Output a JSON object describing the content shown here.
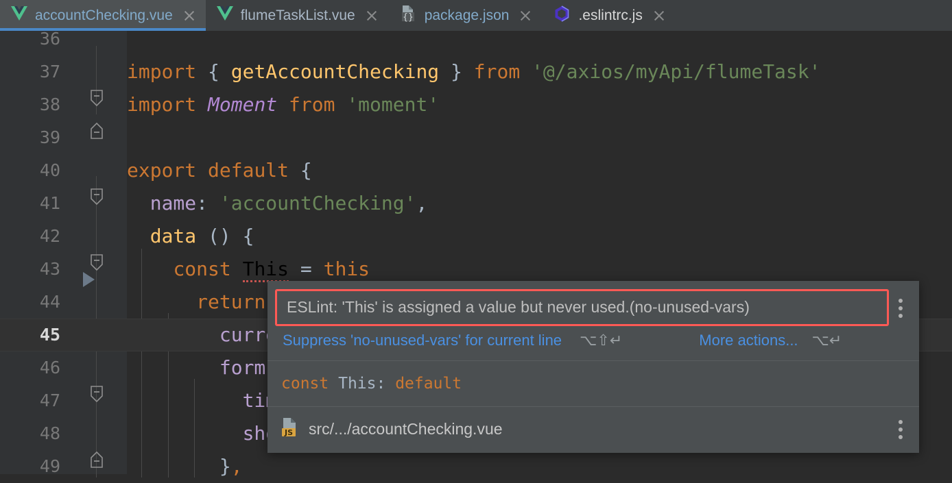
{
  "tabs": [
    {
      "label": "accountChecking.vue",
      "icon": "vue-icon",
      "active": true,
      "close": "close-icon"
    },
    {
      "label": "flumeTaskList.vue",
      "icon": "vue-icon",
      "active": false,
      "close": "close-icon"
    },
    {
      "label": "package.json",
      "icon": "json-file-icon",
      "active": false,
      "close": "close-icon"
    },
    {
      "label": ".eslintrc.js",
      "icon": "eslint-icon",
      "active": false,
      "close": "close-icon"
    }
  ],
  "editor": {
    "lines": [
      {
        "num": "36",
        "current": false,
        "segments": []
      },
      {
        "num": "37",
        "current": false,
        "segments": [
          {
            "t": "import",
            "c": "kw"
          },
          {
            "t": " ",
            "c": "pun"
          },
          {
            "t": "{",
            "c": "pun"
          },
          {
            "t": " ",
            "c": "pun"
          },
          {
            "t": "getAccountChecking",
            "c": "fn"
          },
          {
            "t": " ",
            "c": "pun"
          },
          {
            "t": "}",
            "c": "pun"
          },
          {
            "t": " ",
            "c": "pun"
          },
          {
            "t": "from",
            "c": "kw"
          },
          {
            "t": " ",
            "c": "pun"
          },
          {
            "t": "'@/axios/myApi/flumeTask'",
            "c": "str"
          }
        ]
      },
      {
        "num": "38",
        "current": false,
        "segments": [
          {
            "t": "import",
            "c": "kw"
          },
          {
            "t": " ",
            "c": "pun"
          },
          {
            "t": "Moment",
            "c": "ital"
          },
          {
            "t": " ",
            "c": "pun"
          },
          {
            "t": "from",
            "c": "kw"
          },
          {
            "t": " ",
            "c": "pun"
          },
          {
            "t": "'moment'",
            "c": "str"
          }
        ]
      },
      {
        "num": "39",
        "current": false,
        "segments": []
      },
      {
        "num": "40",
        "current": false,
        "segments": [
          {
            "t": "export",
            "c": "kw"
          },
          {
            "t": " ",
            "c": "pun"
          },
          {
            "t": "default",
            "c": "kw"
          },
          {
            "t": " ",
            "c": "pun"
          },
          {
            "t": "{",
            "c": "pun"
          }
        ]
      },
      {
        "num": "41",
        "current": false,
        "segments": [
          {
            "t": "  ",
            "c": "pun"
          },
          {
            "t": "name",
            "c": "prop"
          },
          {
            "t": ": ",
            "c": "pun"
          },
          {
            "t": "'accountChecking'",
            "c": "str"
          },
          {
            "t": ",",
            "c": "pun"
          }
        ]
      },
      {
        "num": "42",
        "current": false,
        "segments": [
          {
            "t": "  ",
            "c": "pun"
          },
          {
            "t": "data",
            "c": "fn"
          },
          {
            "t": " ",
            "c": "pun"
          },
          {
            "t": "() {",
            "c": "pun"
          }
        ]
      },
      {
        "num": "43",
        "current": false,
        "segments": [
          {
            "t": "    ",
            "c": "pun"
          },
          {
            "t": "const",
            "c": "kw"
          },
          {
            "t": " ",
            "c": "pun"
          },
          {
            "t": "This",
            "c": "squig"
          },
          {
            "t": " ",
            "c": "pun"
          },
          {
            "t": "= ",
            "c": "pun"
          },
          {
            "t": "this",
            "c": "kw"
          }
        ]
      },
      {
        "num": "44",
        "current": false,
        "segments": [
          {
            "t": "      ",
            "c": "pun"
          },
          {
            "t": "return",
            "c": "kw"
          },
          {
            "t": " ",
            "c": "pun"
          },
          {
            "t": "{",
            "c": "pun"
          }
        ]
      },
      {
        "num": "45",
        "current": true,
        "segments": [
          {
            "t": "        ",
            "c": "pun"
          },
          {
            "t": "current",
            "c": "prop"
          }
        ]
      },
      {
        "num": "46",
        "current": false,
        "segments": [
          {
            "t": "        ",
            "c": "pun"
          },
          {
            "t": "formInl",
            "c": "prop"
          }
        ]
      },
      {
        "num": "47",
        "current": false,
        "segments": [
          {
            "t": "          ",
            "c": "pun"
          },
          {
            "t": "timeR",
            "c": "prop"
          }
        ]
      },
      {
        "num": "48",
        "current": false,
        "segments": [
          {
            "t": "          ",
            "c": "pun"
          },
          {
            "t": "showW",
            "c": "prop"
          }
        ]
      },
      {
        "num": "49",
        "current": false,
        "segments": [
          {
            "t": "        ",
            "c": "pun"
          },
          {
            "t": "}",
            "c": "pun"
          },
          {
            "t": ",",
            "c": "kw"
          }
        ]
      }
    ]
  },
  "popup": {
    "message": "ESLint: 'This' is assigned a value but never used.(no-unused-vars)",
    "suppress_action": "Suppress 'no-unused-vars' for current line",
    "suppress_shortcut": "⌥⇧↵",
    "more_actions": "More actions...",
    "more_shortcut": "⌥↵",
    "signature_keyword": "const",
    "signature_name": " This: ",
    "signature_type": "default",
    "file_path": "src/.../accountChecking.vue",
    "file_icon": "js-file-icon",
    "kebab_icon": "more-options-icon"
  },
  "colors": {
    "tabbar_bg": "#3c3f41",
    "active_tab_bg": "#4e5254",
    "active_tab_underline": "#4a88c7",
    "editor_bg": "#2b2b2b",
    "gutter_bg": "#313335",
    "popup_bg": "#4b4f51",
    "error_border": "#ff5a55",
    "link": "#4a90e2",
    "keyword": "#cc7832",
    "string": "#6a8759",
    "function": "#ffc66d",
    "property": "#b9a0d0"
  }
}
